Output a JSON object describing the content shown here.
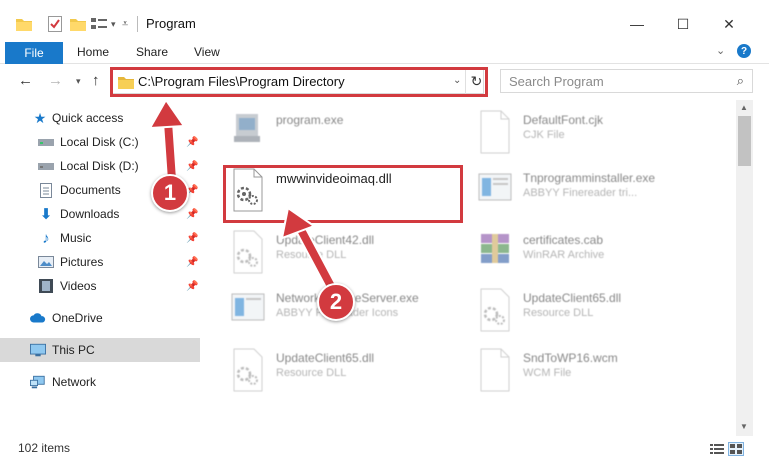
{
  "window": {
    "title": "Program",
    "controls": {
      "minimize": "—",
      "maximize": "☐",
      "close": "✕"
    }
  },
  "ribbon": {
    "tabs": [
      {
        "label": "File"
      },
      {
        "label": "Home"
      },
      {
        "label": "Share"
      },
      {
        "label": "View"
      }
    ],
    "help": "?"
  },
  "address_bar": {
    "path": "C:\\Program Files\\Program Directory",
    "search_placeholder": "Search Program"
  },
  "sidebar": {
    "items": [
      {
        "label": "Quick access",
        "icon": "star-icon",
        "pinned": false
      },
      {
        "label": "Local Disk (C:)",
        "icon": "drive-icon",
        "pinned": true
      },
      {
        "label": "Local Disk (D:)",
        "icon": "drive-icon",
        "pinned": true
      },
      {
        "label": "Documents",
        "icon": "documents-icon",
        "pinned": true
      },
      {
        "label": "Downloads",
        "icon": "download-icon",
        "pinned": true
      },
      {
        "label": "Music",
        "icon": "music-icon",
        "pinned": true
      },
      {
        "label": "Pictures",
        "icon": "pictures-icon",
        "pinned": true
      },
      {
        "label": "Videos",
        "icon": "videos-icon",
        "pinned": true
      },
      {
        "label": "OneDrive",
        "icon": "cloud-icon",
        "pinned": false
      },
      {
        "label": "This PC",
        "icon": "computer-icon",
        "pinned": false,
        "selected": true
      },
      {
        "label": "Network",
        "icon": "network-icon",
        "pinned": false
      }
    ]
  },
  "files": [
    {
      "name": "program.exe",
      "type": "",
      "icon": "exe-icon"
    },
    {
      "name": "DefaultFont.cjk",
      "type": "CJK File",
      "icon": "file-icon"
    },
    {
      "name": "mwwinvideoimaq.dll",
      "type": "",
      "icon": "dll-icon",
      "highlighted": true
    },
    {
      "name": "Tnprogramminstaller.exe",
      "type": "ABBYY Finereader tri...",
      "icon": "installer-icon"
    },
    {
      "name": "UpdateClient42.dll",
      "type": "Resource DLL",
      "icon": "dll-icon"
    },
    {
      "name": "certificates.cab",
      "type": "WinRAR Archive",
      "icon": "archive-icon"
    },
    {
      "name": "NetworkLicenseServer.exe",
      "type": "ABBYY Finereader Icons",
      "icon": "installer-icon"
    },
    {
      "name": "UpdateClient65.dll",
      "type": "Resource DLL",
      "icon": "dll-icon"
    },
    {
      "name": "UpdateClient65.dll",
      "type": "Resource DLL",
      "icon": "dll-icon"
    },
    {
      "name": "SndToWP16.wcm",
      "type": "WCM File",
      "icon": "file-icon"
    }
  ],
  "status": {
    "item_count": "102 items"
  },
  "annotations": [
    {
      "label": "1"
    },
    {
      "label": "2"
    }
  ],
  "colors": {
    "accent": "#1979ca",
    "annotation_red": "#d23a3f",
    "selected_bg": "#d9d9d9"
  }
}
